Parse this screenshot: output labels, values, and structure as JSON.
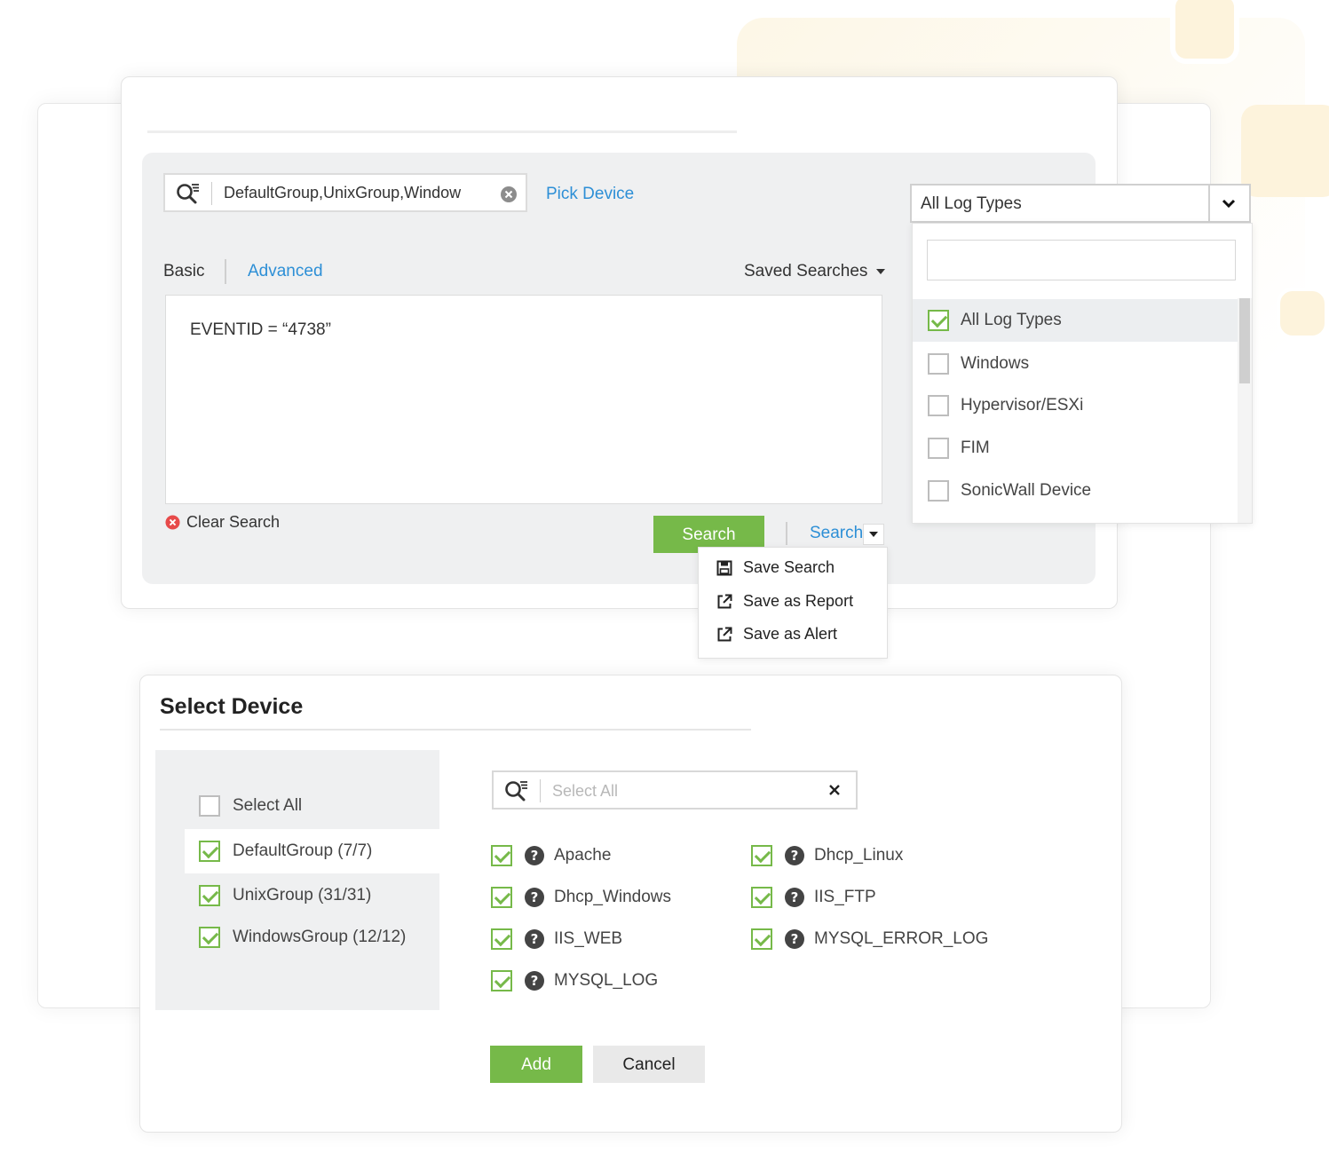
{
  "colors": {
    "accent_green": "#76b949",
    "link_blue": "#2d8fd6",
    "panel_gray": "#eff0f1",
    "clear_red": "#e74a4a"
  },
  "search": {
    "device_value": "DefaultGroup,UnixGroup,Window",
    "pick_device_label": "Pick Device",
    "tabs": {
      "basic": "Basic",
      "advanced": "Advanced"
    },
    "saved_searches_label": "Saved Searches",
    "query": "EVENTID = “4738”",
    "clear_search_label": "Clear Search",
    "search_button": "Search",
    "split_search_label": "Search",
    "save_menu": [
      {
        "label": "Save Search",
        "icon": "save-icon"
      },
      {
        "label": "Save as Report",
        "icon": "external-link-icon"
      },
      {
        "label": "Save as Alert",
        "icon": "external-link-icon"
      }
    ]
  },
  "log_types": {
    "selected": "All Log Types",
    "filter_value": "",
    "options": [
      {
        "label": "All Log Types",
        "checked": true
      },
      {
        "label": "Windows",
        "checked": false
      },
      {
        "label": "Hypervisor/ESXi",
        "checked": false
      },
      {
        "label": "FIM",
        "checked": false
      },
      {
        "label": "SonicWall Device",
        "checked": false
      }
    ]
  },
  "select_device": {
    "title": "Select Device",
    "groups": [
      {
        "label": "Select All",
        "checked": false
      },
      {
        "label": "DefaultGroup (7/7)",
        "checked": true
      },
      {
        "label": "UnixGroup (31/31)",
        "checked": true
      },
      {
        "label": "WindowsGroup (12/12)",
        "checked": true
      }
    ],
    "search_placeholder": "Select All",
    "devices": [
      {
        "label": "Apache",
        "checked": true
      },
      {
        "label": "Dhcp_Linux",
        "checked": true
      },
      {
        "label": "Dhcp_Windows",
        "checked": true
      },
      {
        "label": "IIS_FTP",
        "checked": true
      },
      {
        "label": "IIS_WEB",
        "checked": true
      },
      {
        "label": "MYSQL_ERROR_LOG",
        "checked": true
      },
      {
        "label": "MYSQL_LOG",
        "checked": true
      }
    ],
    "add_button": "Add",
    "cancel_button": "Cancel"
  }
}
